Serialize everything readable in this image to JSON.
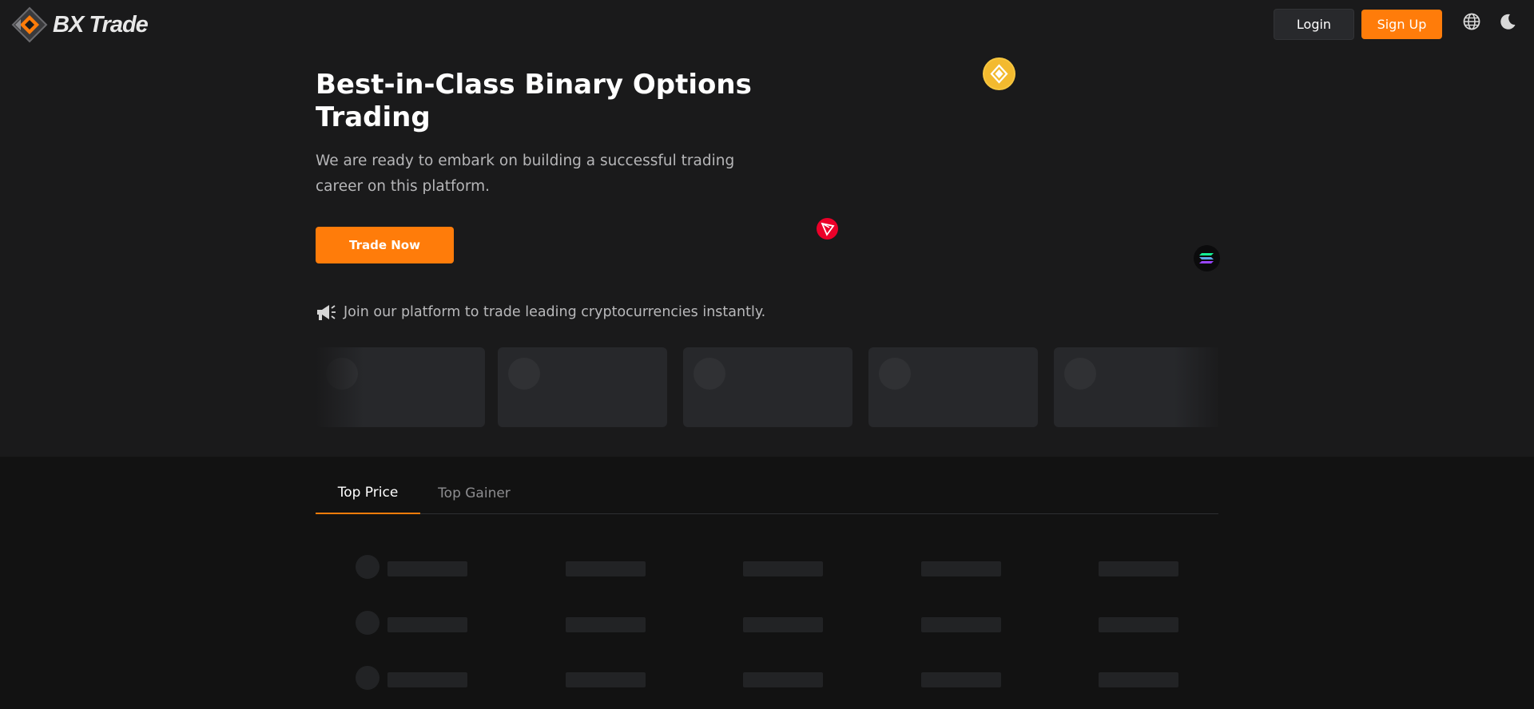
{
  "brand": {
    "name": "BX Trade"
  },
  "header": {
    "login_label": "Login",
    "signup_label": "Sign Up",
    "icons": [
      "globe-icon",
      "moon-icon"
    ]
  },
  "hero": {
    "title": "Best-in-Class Binary Options Trading",
    "subtitle": "We are ready to embark on building a successful trading career on this platform.",
    "cta_label": "Trade Now",
    "announcement": "Join our platform to trade leading cryptocurrencies instantly."
  },
  "floating_coins": [
    "bnb-coin-icon",
    "tron-coin-icon",
    "solana-coin-icon"
  ],
  "market_cards": {
    "count": 5,
    "state": "loading"
  },
  "market_tabs": [
    {
      "label": "Top Price",
      "active": true
    },
    {
      "label": "Top Gainer",
      "active": false
    }
  ],
  "market_table": {
    "state": "loading",
    "rows": 3,
    "columns": 5
  },
  "colors": {
    "accent": "#ff7c0a",
    "background": "#121212",
    "hero_background": "#1a1a1b",
    "skeleton": "#222325"
  }
}
